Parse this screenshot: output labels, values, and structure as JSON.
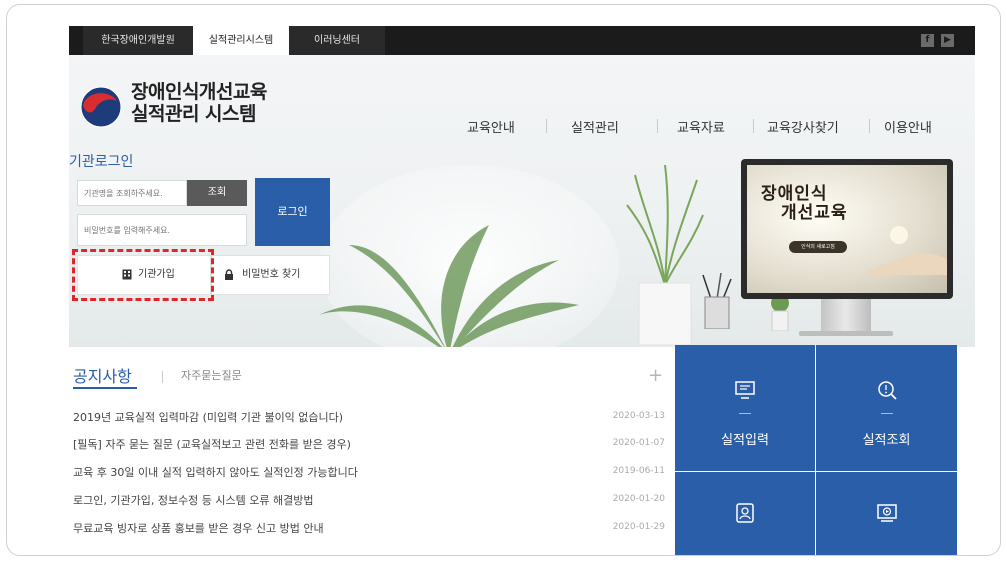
{
  "top_tabs": [
    "한국장애인개발원",
    "실적관리시스템",
    "이러닝센터"
  ],
  "sns": {
    "facebook": "f",
    "youtube": "▶"
  },
  "logo": {
    "line1": "장애인식개선교육",
    "line2": "실적관리 시스템"
  },
  "nav": [
    "교육안내",
    "실적관리",
    "교육자료",
    "교육강사찾기",
    "이용안내"
  ],
  "login": {
    "title": "기관로그인",
    "org_placeholder": "기관명을 조회하주세요.",
    "search_label": "조회",
    "pw_placeholder": "비밀번호를 입력해주세요.",
    "login_label": "로그인",
    "join_label": "기관가입",
    "find_pw_label": "비밀번호 찾기"
  },
  "promo": {
    "title_line1": "장애인식",
    "title_line2": "개선교육",
    "badge": "인식의 새로고침"
  },
  "notices": {
    "tab_active": "공지사항",
    "tab_other": "자주묻는질문",
    "more": "+",
    "items": [
      {
        "title": "2019년 교육실적 입력마감 (미입력 기관 불이익 없습니다)",
        "date": "2020-03-13"
      },
      {
        "title": "[필독] 자주 묻는 질문 (교육실적보고 관련 전화를 받은 경우)",
        "date": "2020-01-07"
      },
      {
        "title": "교육 후 30일 이내 실적 입력하지 않아도 실적인정 가능합니다",
        "date": "2019-06-11"
      },
      {
        "title": "로그인, 기관가입, 정보수정 등 시스템 오류 해결방법",
        "date": "2020-01-20"
      },
      {
        "title": "무료교육 빙자로 상품 홍보를 받은 경우 신고 방법 안내",
        "date": "2020-01-29"
      }
    ]
  },
  "tiles": [
    "실적입력",
    "실적조회"
  ],
  "colors": {
    "primary": "#2a5ea8",
    "highlight": "#e0252b",
    "topbar": "#1b1b1b"
  }
}
